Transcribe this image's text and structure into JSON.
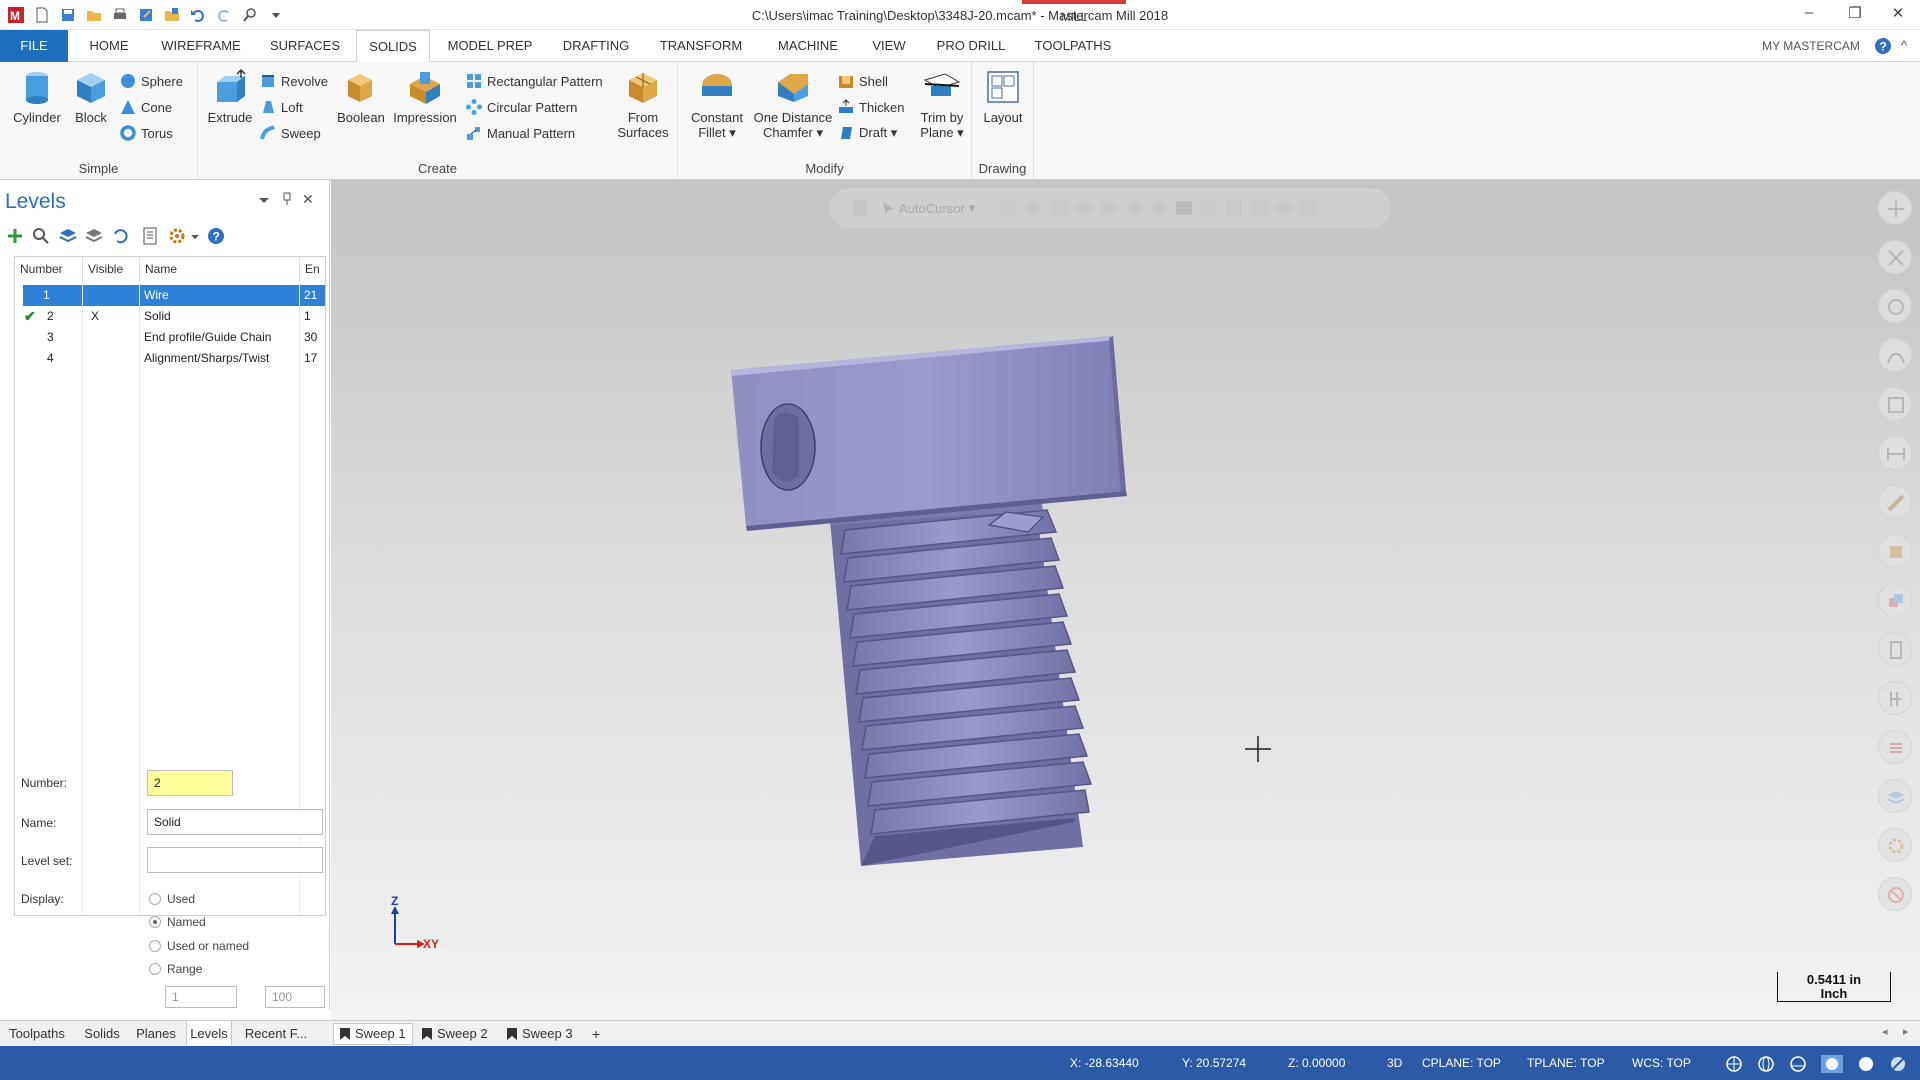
{
  "window": {
    "title": "C:\\Users\\imac Training\\Desktop\\3348J-20.mcam* - Mastercam Mill 2018",
    "context_tab": "MILL",
    "min_icon": "–",
    "restore_icon": "❐",
    "close_icon": "✕"
  },
  "menu": {
    "tabs": [
      "FILE",
      "HOME",
      "WIREFRAME",
      "SURFACES",
      "SOLIDS",
      "MODEL PREP",
      "DRAFTING",
      "TRANSFORM",
      "MACHINE",
      "VIEW",
      "PRO DRILL",
      "TOOLPATHS"
    ],
    "active": "SOLIDS",
    "my_mastercam": "MY MASTERCAM",
    "collapse_glyph": "^"
  },
  "ribbon": {
    "simple": {
      "label": "Simple",
      "cylinder": "Cylinder",
      "block": "Block",
      "sphere": "Sphere",
      "cone": "Cone",
      "torus": "Torus"
    },
    "create": {
      "label": "Create",
      "extrude": "Extrude",
      "revolve": "Revolve",
      "loft": "Loft",
      "sweep": "Sweep",
      "boolean": "Boolean",
      "impression": "Impression",
      "rect_pattern": "Rectangular Pattern",
      "circ_pattern": "Circular Pattern",
      "manual_pattern": "Manual Pattern",
      "from_surfaces_1": "From",
      "from_surfaces_2": "Surfaces"
    },
    "modify": {
      "label": "Modify",
      "const_fillet_1": "Constant",
      "const_fillet_2": "Fillet ▾",
      "one_dist_1": "One Distance",
      "one_dist_2": "Chamfer ▾",
      "shell": "Shell",
      "thicken": "Thicken",
      "draft": "Draft ▾",
      "trim_1": "Trim by",
      "trim_2": "Plane ▾"
    },
    "drawing": {
      "label": "Drawing",
      "layout": "Layout"
    }
  },
  "levels": {
    "title": "Levels",
    "columns": [
      "Number",
      "Visible",
      "Name",
      "En"
    ],
    "rows": [
      {
        "number": "1",
        "visible": "",
        "name": "Wire",
        "entities": "21",
        "active_mark": ""
      },
      {
        "number": "2",
        "visible": "X",
        "name": "Solid",
        "entities": "1",
        "active_mark": "✔"
      },
      {
        "number": "3",
        "visible": "",
        "name": "End profile/Guide Chain",
        "entities": "30",
        "active_mark": ""
      },
      {
        "number": "4",
        "visible": "",
        "name": "Alignment/Sharps/Twist",
        "entities": "17",
        "active_mark": ""
      }
    ],
    "form": {
      "number_label": "Number:",
      "number_value": "2",
      "name_label": "Name:",
      "name_value": "Solid",
      "levelset_label": "Level set:",
      "levelset_value": "",
      "display_label": "Display:",
      "options": [
        "Used",
        "Named",
        "Used or named",
        "Range"
      ],
      "selected_option": "Named",
      "range_from": "1",
      "range_to": "100"
    }
  },
  "panel_tabs": [
    "Toolpaths",
    "Solids",
    "Planes",
    "Levels",
    "Recent F..."
  ],
  "panel_tab_active": "Levels",
  "view_tabs": [
    "Sweep 1",
    "Sweep 2",
    "Sweep 3"
  ],
  "view_tab_active": "Sweep 1",
  "view_tab_add": "+",
  "viewport": {
    "autocursor": "AutoCursor",
    "axis_z": "Z",
    "axis_xy": "XY",
    "scale_value": "0.5411 in",
    "scale_unit": "Inch"
  },
  "status": {
    "x": "X:   -28.63440",
    "y": "Y:   20.57274",
    "z": "Z:   0.00000",
    "mode": "3D",
    "cplane": "CPLANE: TOP",
    "tplane": "TPLANE: TOP",
    "wcs": "WCS: TOP"
  },
  "colors": {
    "accent": "#1f6fbf",
    "selection": "#2d82d7",
    "status_bar": "#2b5aa6",
    "part_body": "#8f8fc0",
    "number_field": "#ffff99"
  }
}
